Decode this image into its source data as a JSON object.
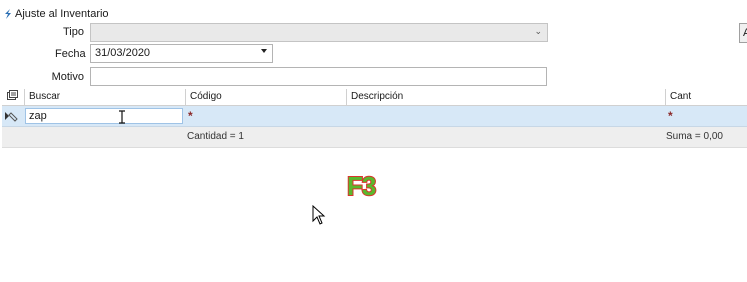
{
  "window": {
    "title": "Ajuste al Inventario"
  },
  "form": {
    "tipo_label": "Tipo",
    "tipo_value": "",
    "fecha_label": "Fecha",
    "fecha_value": "31/03/2020",
    "motivo_label": "Motivo",
    "motivo_value": ""
  },
  "side_button": {
    "label": "A"
  },
  "grid": {
    "columns": [
      "Buscar",
      "Código",
      "Descripción",
      "Cant"
    ],
    "row": {
      "buscar": "zap",
      "codigo": "*",
      "descripcion": "",
      "cant": "*"
    },
    "footer": {
      "cantidad": "Cantidad = 1",
      "suma": "Suma = 0,00"
    }
  },
  "overlay": {
    "key_hint": "F3"
  },
  "icons": {
    "app": "app-icon",
    "grid_header": "grid-columns-icon",
    "row_indicator": "row-edit-indicator-icon",
    "text_cursor": "ibeam-cursor-icon",
    "mouse": "mouse-pointer-icon"
  },
  "colors": {
    "row_selected": "#d7e8f7",
    "f3_fill": "#5ab82d",
    "f3_stroke": "#d9352c",
    "required_star": "#8b2a2a"
  }
}
